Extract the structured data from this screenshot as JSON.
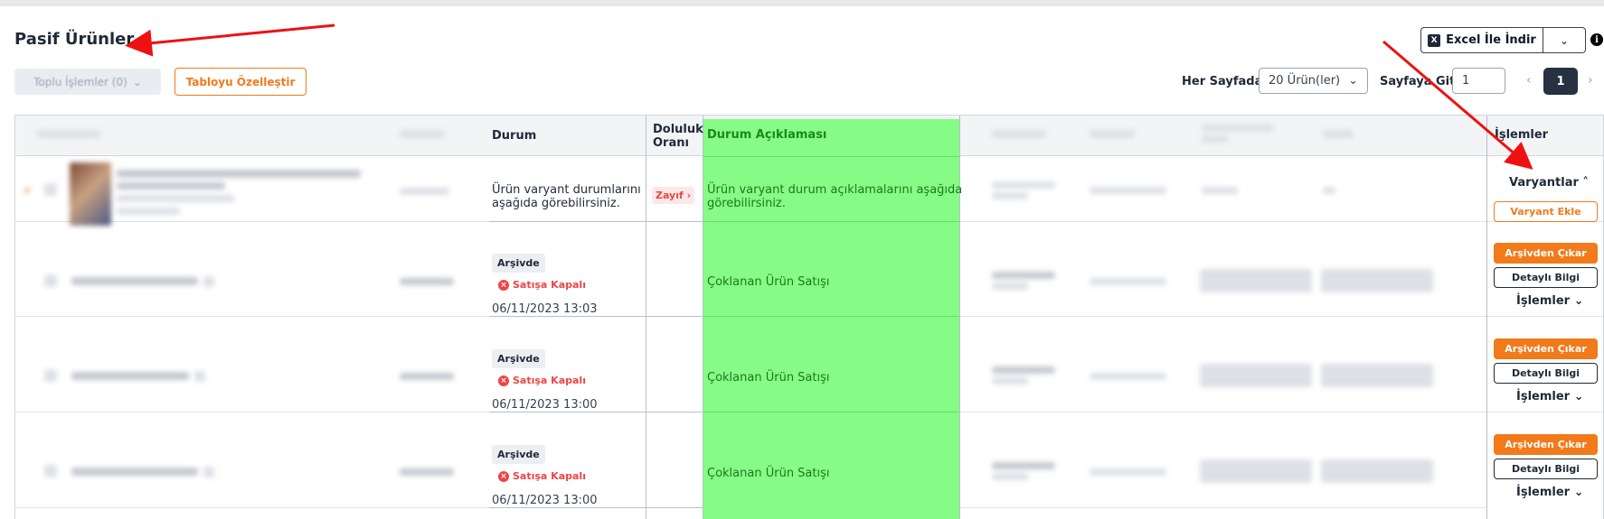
{
  "page": {
    "title": "Pasif Ürünler"
  },
  "toolbar": {
    "bulk_label": "Toplu İşlemler (0)",
    "customize_label": "Tabloyu Özelleştir",
    "excel_label": "Excel İle İndir",
    "per_page_label": "Her Sayfada",
    "per_page_value": "20 Ürün(ler)",
    "goto_label": "Sayfaya Git",
    "goto_value": "1",
    "current_page": "1"
  },
  "table": {
    "headers": {
      "durum": "Durum",
      "doluluk_line1": "Doluluk",
      "doluluk_line2": "Oranı",
      "aciklama": "Durum Açıklaması",
      "islemler": "İşlemler"
    },
    "rows": [
      {
        "durum_text_1": "Ürün varyant durumlarını",
        "durum_text_2": "aşağıda görebilirsiniz.",
        "doluluk": "Zayıf",
        "aciklama_1": "Ürün varyant durum açıklamalarını aşağıda",
        "aciklama_2": "görebilirsiniz.",
        "ops_toggle": "Varyantlar",
        "ops_button": "Varyant Ekle"
      },
      {
        "badge": "Arşivde",
        "sale_status": "Satışa Kapalı",
        "date": "06/11/2023 13:03",
        "aciklama": "Çoklanan Ürün Satışı",
        "btn_unarchive": "Arşivden Çıkar",
        "btn_details": "Detaylı Bilgi",
        "ops_menu": "İşlemler"
      },
      {
        "badge": "Arşivde",
        "sale_status": "Satışa Kapalı",
        "date": "06/11/2023 13:00",
        "aciklama": "Çoklanan Ürün Satışı",
        "btn_unarchive": "Arşivden Çıkar",
        "btn_details": "Detaylı Bilgi",
        "ops_menu": "İşlemler"
      },
      {
        "badge": "Arşivde",
        "sale_status": "Satışa Kapalı",
        "date": "06/11/2023 13:00",
        "aciklama": "Çoklanan Ürün Satışı",
        "btn_unarchive": "Arşivden Çıkar",
        "btn_details": "Detaylı Bilgi",
        "ops_menu": "İşlemler"
      }
    ]
  },
  "colors": {
    "accent": "#f27a1a",
    "highlight": "#86fb86",
    "danger": "#ef4444",
    "annotation_arrow": "#ee1111"
  },
  "icons": {
    "excel": "excel-icon",
    "info": "info-icon",
    "chevron": "chevron-down-icon",
    "close": "x-circle-icon"
  }
}
